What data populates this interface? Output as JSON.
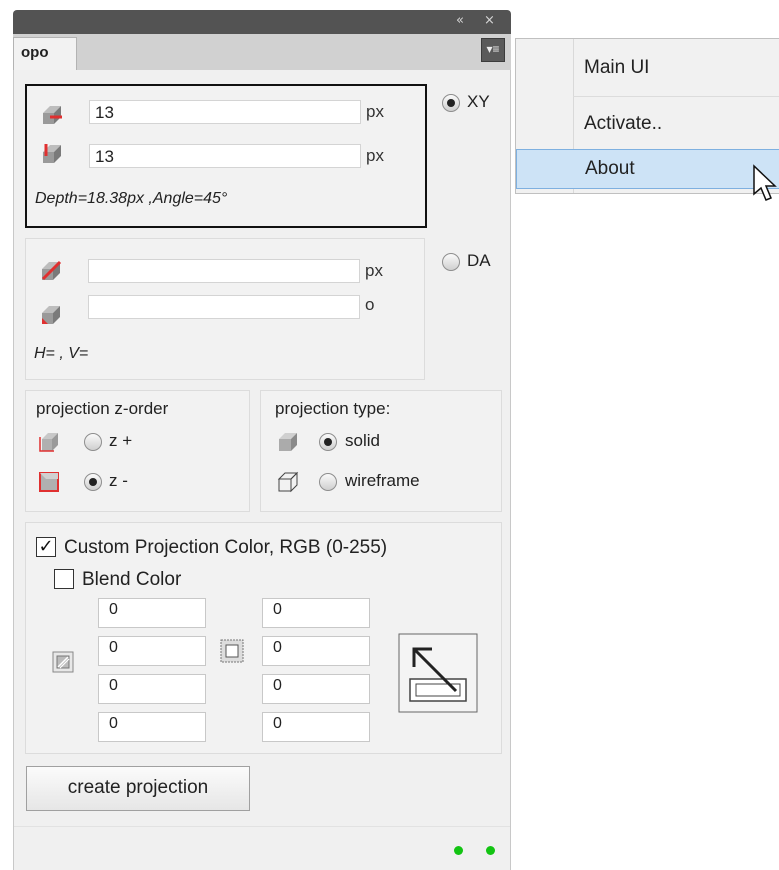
{
  "window": {
    "collapse_glyph": "«",
    "close_glyph": "×",
    "tab_label": "opo",
    "flyout_glyph": "▾≡"
  },
  "xy_section": {
    "horizontal_value": "13",
    "horizontal_unit": "px",
    "vertical_value": "13",
    "vertical_unit": "px",
    "summary": "Depth=18.38px ,Angle=45°",
    "radio_label": "XY",
    "selected": true
  },
  "da_section": {
    "depth_value": "",
    "depth_unit": "px",
    "angle_value": "",
    "angle_unit": "o",
    "summary": "H= , V=",
    "radio_label": "DA",
    "selected": false
  },
  "zorder": {
    "title": "projection z-order",
    "options": [
      {
        "label": "z +",
        "selected": false,
        "icon": "cube-front-icon"
      },
      {
        "label": "z -",
        "selected": true,
        "icon": "cube-back-icon"
      }
    ]
  },
  "ptype": {
    "title": "projection type:",
    "options": [
      {
        "label": "solid",
        "selected": true,
        "icon": "solid-cube-icon"
      },
      {
        "label": "wireframe",
        "selected": false,
        "icon": "wireframe-cube-icon"
      }
    ]
  },
  "color": {
    "custom_label": "Custom Projection Color, RGB (0-255)",
    "custom_checked": true,
    "blend_label": "Blend Color",
    "blend_checked": false,
    "left_values": [
      "0",
      "0",
      "0",
      "0"
    ],
    "right_values": [
      "0",
      "0",
      "0",
      "0"
    ]
  },
  "actions": {
    "create_label": "create projection"
  },
  "context_menu": {
    "items": [
      {
        "label": "Main UI",
        "highlighted": false
      },
      {
        "label": "Activate..",
        "highlighted": false
      },
      {
        "label": "About",
        "highlighted": true
      }
    ]
  },
  "colors": {
    "accent_red": "#e03030",
    "status_green": "#13c413",
    "menu_highlight": "#cde3f6"
  }
}
